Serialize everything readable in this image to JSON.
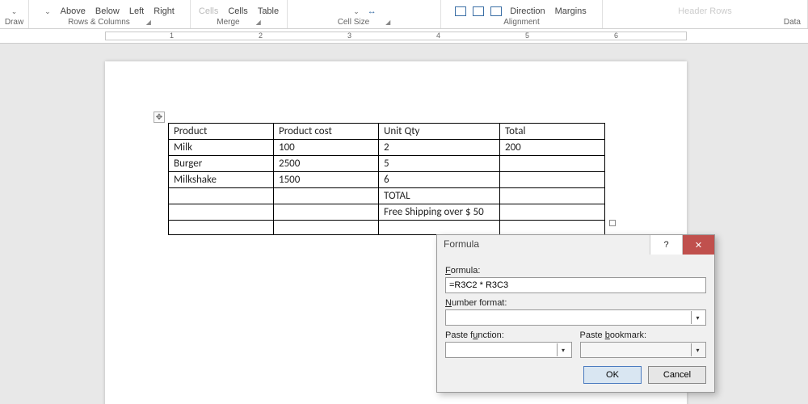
{
  "ribbon": {
    "draw": "Draw",
    "rows_cols_label": "Rows & Columns",
    "above": "Above",
    "below": "Below",
    "left": "Left",
    "right": "Right",
    "merge_label": "Merge",
    "merge_cells": "Cells",
    "split_cells": "Cells",
    "split_table": "Table",
    "cellsize_label": "Cell Size",
    "align_label": "Alignment",
    "direction": "Direction",
    "margins": "Margins",
    "header_rows": "Header Rows",
    "data": "Data"
  },
  "ruler": {
    "n1": "1",
    "n2": "2",
    "n3": "3",
    "n4": "4",
    "n5": "5",
    "n6": "6"
  },
  "table": {
    "headers": {
      "c1": "Product",
      "c2": "Product cost",
      "c3": "Unit Qty",
      "c4": "Total"
    },
    "rows": [
      {
        "c1": "Milk",
        "c2": "100",
        "c3": "2",
        "c4": "200"
      },
      {
        "c1": "Burger",
        "c2": "2500",
        "c3": "5",
        "c4": ""
      },
      {
        "c1": "Milkshake",
        "c2": "1500",
        "c3": "6",
        "c4": ""
      },
      {
        "c1": "",
        "c2": "",
        "c3": "TOTAL",
        "c4": ""
      },
      {
        "c1": "",
        "c2": "",
        "c3": "Free Shipping over $ 50",
        "c4": ""
      },
      {
        "c1": "",
        "c2": "",
        "c3": "",
        "c4": ""
      }
    ]
  },
  "dialog": {
    "title": "Formula",
    "formula_label": "Formula:",
    "formula_value": "=R3C2 * R3C3",
    "number_format_label": "Number format:",
    "number_format_value": "",
    "paste_function_label": "Paste function:",
    "paste_bookmark_label": "Paste bookmark:",
    "ok": "OK",
    "cancel": "Cancel",
    "help": "?",
    "close": "✕"
  },
  "anchor_glyph": "✥"
}
